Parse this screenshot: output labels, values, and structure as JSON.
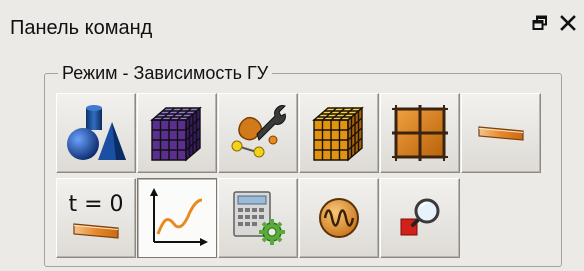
{
  "window": {
    "title": "Панель команд",
    "controls": [
      {
        "icon": "float-window-icon"
      },
      {
        "icon": "close-icon",
        "label": "✕"
      }
    ]
  },
  "group": {
    "label": "Режим - Зависимость ГУ"
  },
  "buttons": [
    {
      "id": "geometry",
      "icon": "geometry-primitives-icon",
      "selected": false
    },
    {
      "id": "mesh",
      "icon": "purple-mesh-cube-icon",
      "selected": false
    },
    {
      "id": "tools",
      "icon": "wrench-settings-icon",
      "selected": false
    },
    {
      "id": "solid-mesh",
      "icon": "orange-mesh-cube-icon",
      "selected": false
    },
    {
      "id": "grid-2d",
      "icon": "grid-panel-icon",
      "selected": false
    },
    {
      "id": "boundary",
      "icon": "boundary-layer-icon",
      "selected": false
    },
    {
      "id": "initial-condition",
      "icon": "initial-condition-icon",
      "text": "t = 0",
      "selected": false
    },
    {
      "id": "dependency",
      "icon": "dependency-curve-icon",
      "selected": true
    },
    {
      "id": "calculator",
      "icon": "calculator-gear-icon",
      "selected": false
    },
    {
      "id": "oscillation",
      "icon": "oscillation-icon",
      "selected": false
    },
    {
      "id": "inspect",
      "icon": "magnifier-inspect-icon",
      "selected": false
    }
  ]
}
